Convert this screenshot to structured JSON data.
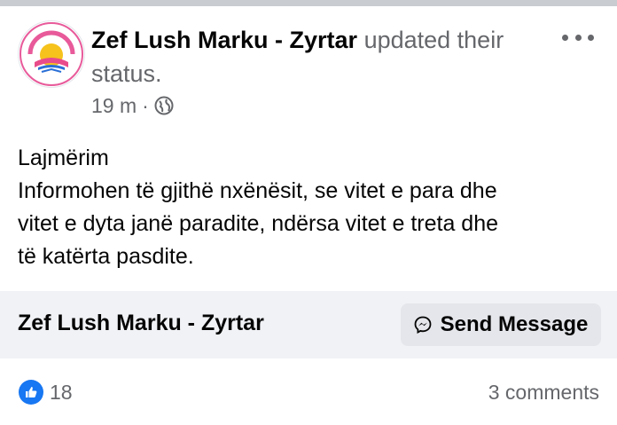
{
  "post": {
    "author": "Zef Lush Marku - Zyrtar",
    "action": "updated their status.",
    "time": "19 m",
    "separator": "·",
    "privacy_icon": "globe-icon",
    "more_icon": "more-horizontal-icon",
    "body": {
      "title": "Lajmërim",
      "lines": [
        "Informohen të gjithë nxënësit, se vitet e para dhe",
        "vitet e dyta janë  paradite, ndërsa vitet e treta dhe",
        "të katërta pasdite."
      ]
    }
  },
  "cta": {
    "page_name": "Zef Lush Marku - Zyrtar",
    "button_label": "Send Message",
    "button_icon": "messenger-icon"
  },
  "stats": {
    "reaction_icon": "like-icon",
    "reaction_count": "18",
    "comments": "3 comments"
  },
  "colors": {
    "like_blue": "#1877f2",
    "secondary_text": "#65676b",
    "cta_background": "#f0f2f5",
    "button_background": "#e4e6eb"
  }
}
